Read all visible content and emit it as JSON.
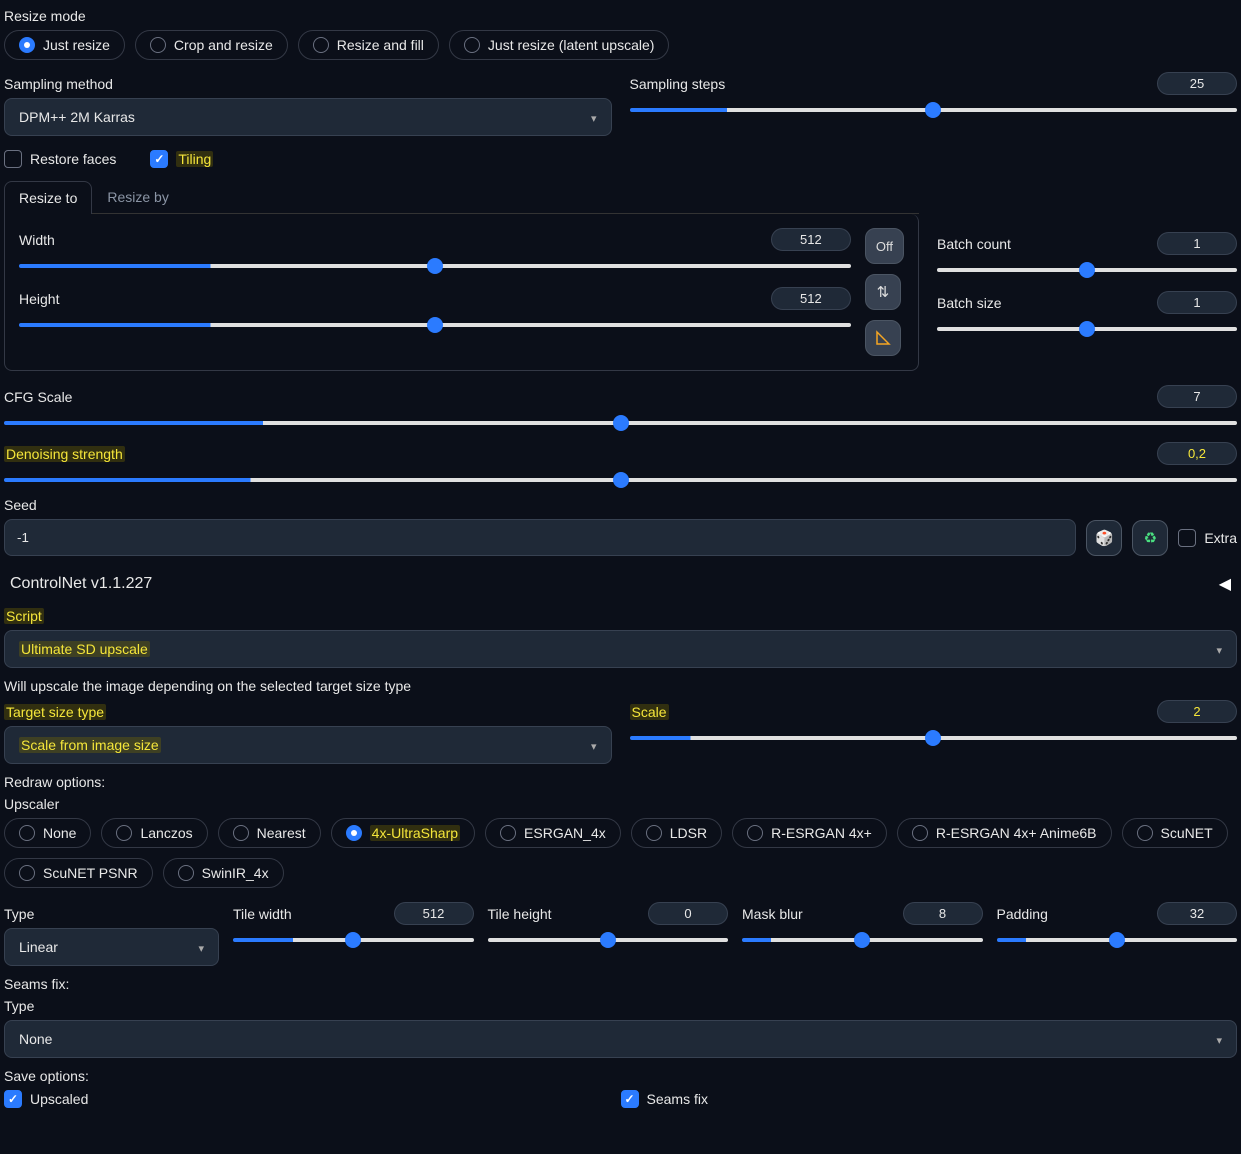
{
  "resizeMode": {
    "label": "Resize mode",
    "options": [
      "Just resize",
      "Crop and resize",
      "Resize and fill",
      "Just resize (latent upscale)"
    ],
    "selected": 0
  },
  "samplingMethod": {
    "label": "Sampling method",
    "value": "DPM++ 2M Karras"
  },
  "samplingSteps": {
    "label": "Sampling steps",
    "value": "25",
    "pct": 16
  },
  "restoreFaces": {
    "label": "Restore faces",
    "checked": false
  },
  "tiling": {
    "label": "Tiling",
    "checked": true
  },
  "resizeTabs": {
    "options": [
      "Resize to",
      "Resize by"
    ],
    "selected": 0
  },
  "width": {
    "label": "Width",
    "value": "512",
    "pct": 23
  },
  "height": {
    "label": "Height",
    "value": "512",
    "pct": 23
  },
  "offBtn": "Off",
  "batchCount": {
    "label": "Batch count",
    "value": "1",
    "pct": 0
  },
  "batchSize": {
    "label": "Batch size",
    "value": "1",
    "pct": 0
  },
  "cfg": {
    "label": "CFG Scale",
    "value": "7",
    "pct": 21
  },
  "denoise": {
    "label": "Denoising strength",
    "value": "0,2",
    "pct": 20
  },
  "seed": {
    "label": "Seed",
    "value": "-1"
  },
  "extra": {
    "label": "Extra",
    "checked": false
  },
  "controlnet": "ControlNet v1.1.227",
  "script": {
    "label": "Script",
    "value": "Ultimate SD upscale"
  },
  "scriptDesc": "Will upscale the image depending on the selected target size type",
  "targetSize": {
    "label": "Target size type",
    "value": "Scale from image size"
  },
  "scale": {
    "label": "Scale",
    "value": "2",
    "pct": 10
  },
  "redrawLabel": "Redraw options:",
  "upscaler": {
    "label": "Upscaler",
    "options": [
      "None",
      "Lanczos",
      "Nearest",
      "4x-UltraSharp",
      "ESRGAN_4x",
      "LDSR",
      "R-ESRGAN 4x+",
      "R-ESRGAN 4x+ Anime6B",
      "ScuNET",
      "ScuNET PSNR",
      "SwinIR_4x"
    ],
    "selected": 3
  },
  "type": {
    "label": "Type",
    "value": "Linear"
  },
  "tileWidth": {
    "label": "Tile width",
    "value": "512",
    "pct": 25
  },
  "tileHeight": {
    "label": "Tile height",
    "value": "0",
    "pct": 0
  },
  "maskBlur": {
    "label": "Mask blur",
    "value": "8",
    "pct": 12
  },
  "padding": {
    "label": "Padding",
    "value": "32",
    "pct": 12
  },
  "seamsLabel": "Seams fix:",
  "seamsType": {
    "label": "Type",
    "value": "None"
  },
  "saveLabel": "Save options:",
  "upscaledCb": {
    "label": "Upscaled",
    "checked": true
  },
  "seamsFixCb": {
    "label": "Seams fix",
    "checked": true
  }
}
